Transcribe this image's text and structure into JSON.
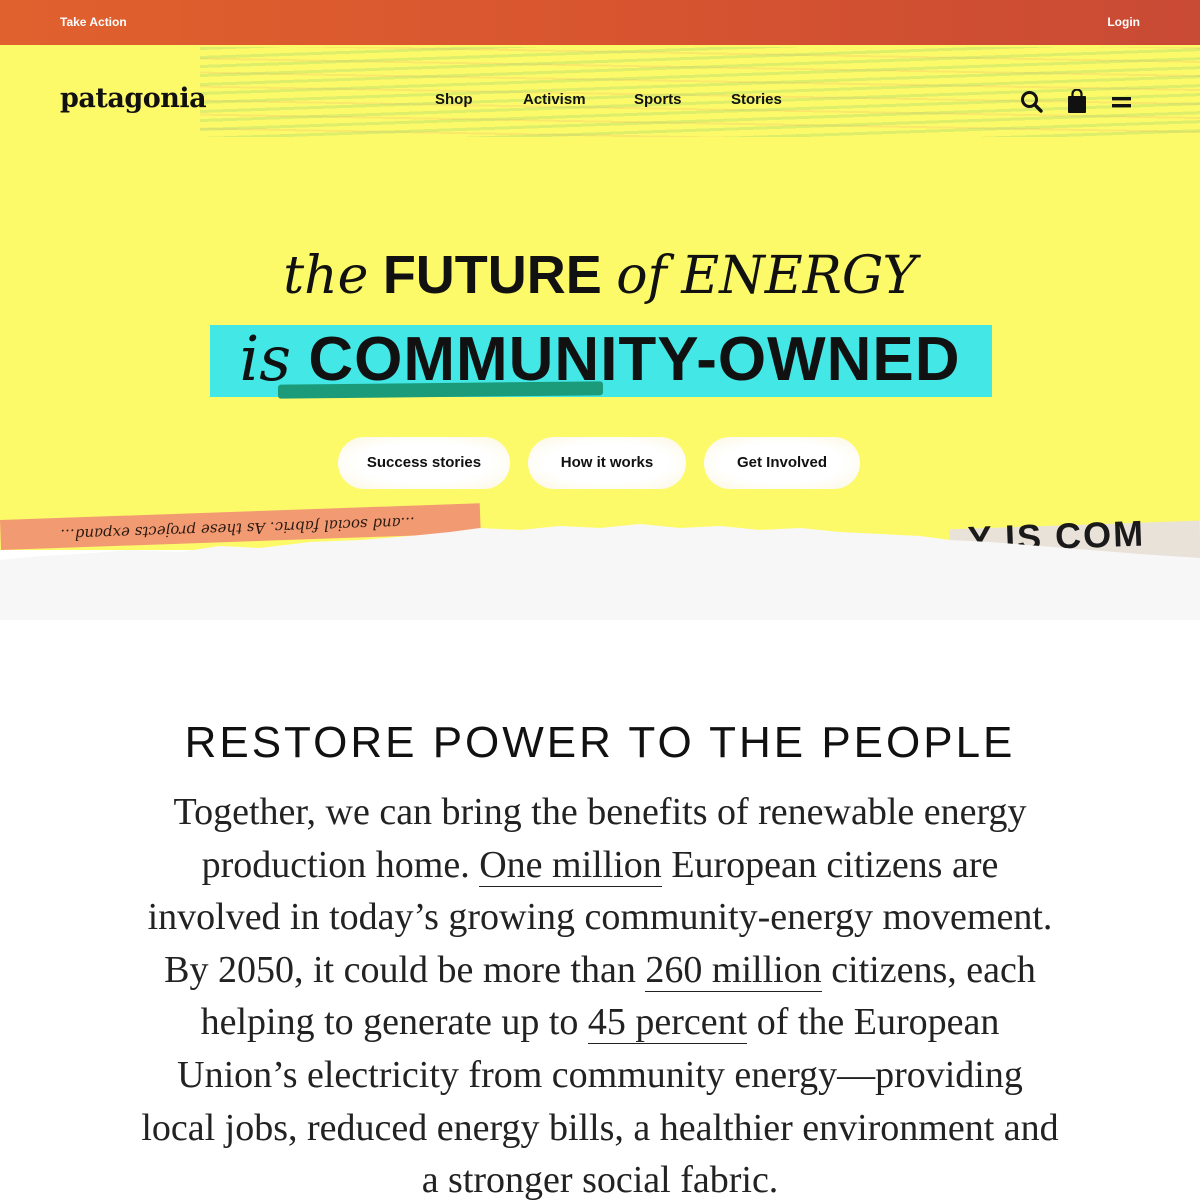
{
  "topbar": {
    "take_action": "Take Action",
    "login": "Login"
  },
  "header": {
    "logo": "patagonia",
    "nav": [
      {
        "label": "Shop"
      },
      {
        "label": "Activism"
      },
      {
        "label": "Sports"
      },
      {
        "label": "Stories"
      }
    ],
    "icons": [
      "search-icon",
      "shopping-bag-icon",
      "menu-icon"
    ]
  },
  "hero": {
    "line1": {
      "w1": "the",
      "w2": "FUTURE",
      "w3": "of",
      "w4": "ENERGY"
    },
    "line2": {
      "w1": "is",
      "w2": "COMMUNITY-OWNED"
    },
    "buttons": [
      "Success stories",
      "How it works",
      "Get Involved"
    ],
    "scrap_left": "...and social fabric. As these projects expand...",
    "scrap_right": "Y IS COM"
  },
  "main": {
    "title": "RESTORE POWER TO THE PEOPLE",
    "p1": "Together, we can bring the benefits of renewable energy production home.",
    "hl1": "One million",
    "p2": "European citizens are involved in today’s growing community-energy movement. By 2050, it could be more than",
    "hl2": "260 million",
    "p3": "citizens, each helping to generate up to",
    "hl3": "45 percent",
    "p4": "of the European Union’s electricity from community energy—providing local jobs, reduced energy bills, a healthier environment and a stronger social fabric."
  },
  "colors": {
    "topbar": "#d8552f",
    "hero_bg": "#fdfa6a",
    "cyan_highlight": "#43e7e5",
    "green_underline": "#1c9b7a",
    "orange_scrap": "#f29b73"
  }
}
